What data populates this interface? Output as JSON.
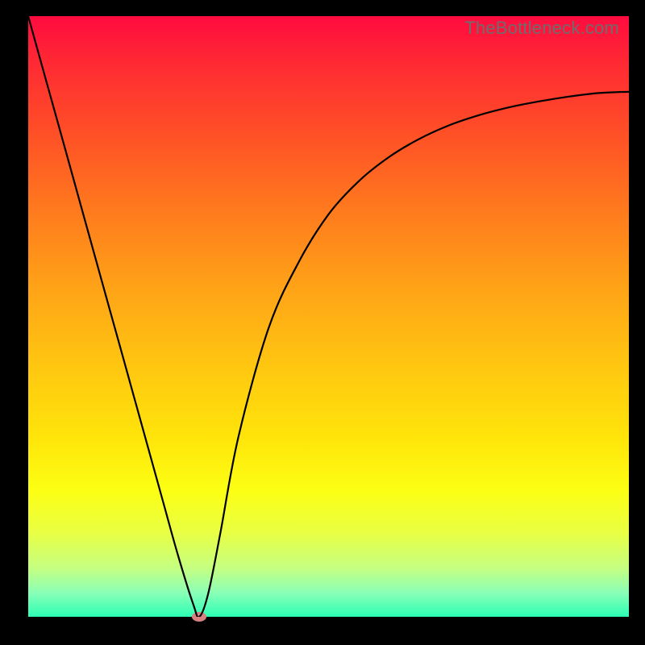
{
  "watermark": "TheBottleneck.com",
  "colors": {
    "frame": "#000000",
    "curve": "#000000",
    "marker": "#d98080",
    "gradient": [
      "#ff0b3f",
      "#ff2a33",
      "#ff5126",
      "#ff7c1d",
      "#ffa217",
      "#ffc311",
      "#ffe40a",
      "#fcff13",
      "#e9ff44",
      "#c4ff82",
      "#8affb7",
      "#2cffb4"
    ]
  },
  "chart_data": {
    "type": "line",
    "title": "",
    "xlabel": "",
    "ylabel": "",
    "xlim": [
      0,
      100
    ],
    "ylim": [
      0,
      100
    ],
    "grid": false,
    "legend": false,
    "note": "V-shaped bottleneck curve; x left-to-right 0→100, y bottom-to-top 0→100 (estimated from pixels, no labeled axes)",
    "series": [
      {
        "name": "bottleneck-curve",
        "x": [
          0,
          2.5,
          5,
          7.5,
          10,
          12.5,
          15,
          17.5,
          20,
          22.5,
          25,
          27.5,
          28.5,
          30,
          32,
          35,
          40,
          45,
          50,
          55,
          60,
          65,
          70,
          75,
          80,
          85,
          90,
          95,
          100
        ],
        "values": [
          100,
          91,
          82,
          73,
          64,
          55,
          46,
          37,
          28,
          19,
          10,
          2,
          0,
          4,
          14,
          30,
          48,
          59,
          67,
          72.5,
          76.5,
          79.5,
          81.8,
          83.5,
          84.8,
          85.8,
          86.6,
          87.2,
          87.4
        ]
      }
    ],
    "marker": {
      "x": 28.5,
      "y": 0
    }
  }
}
